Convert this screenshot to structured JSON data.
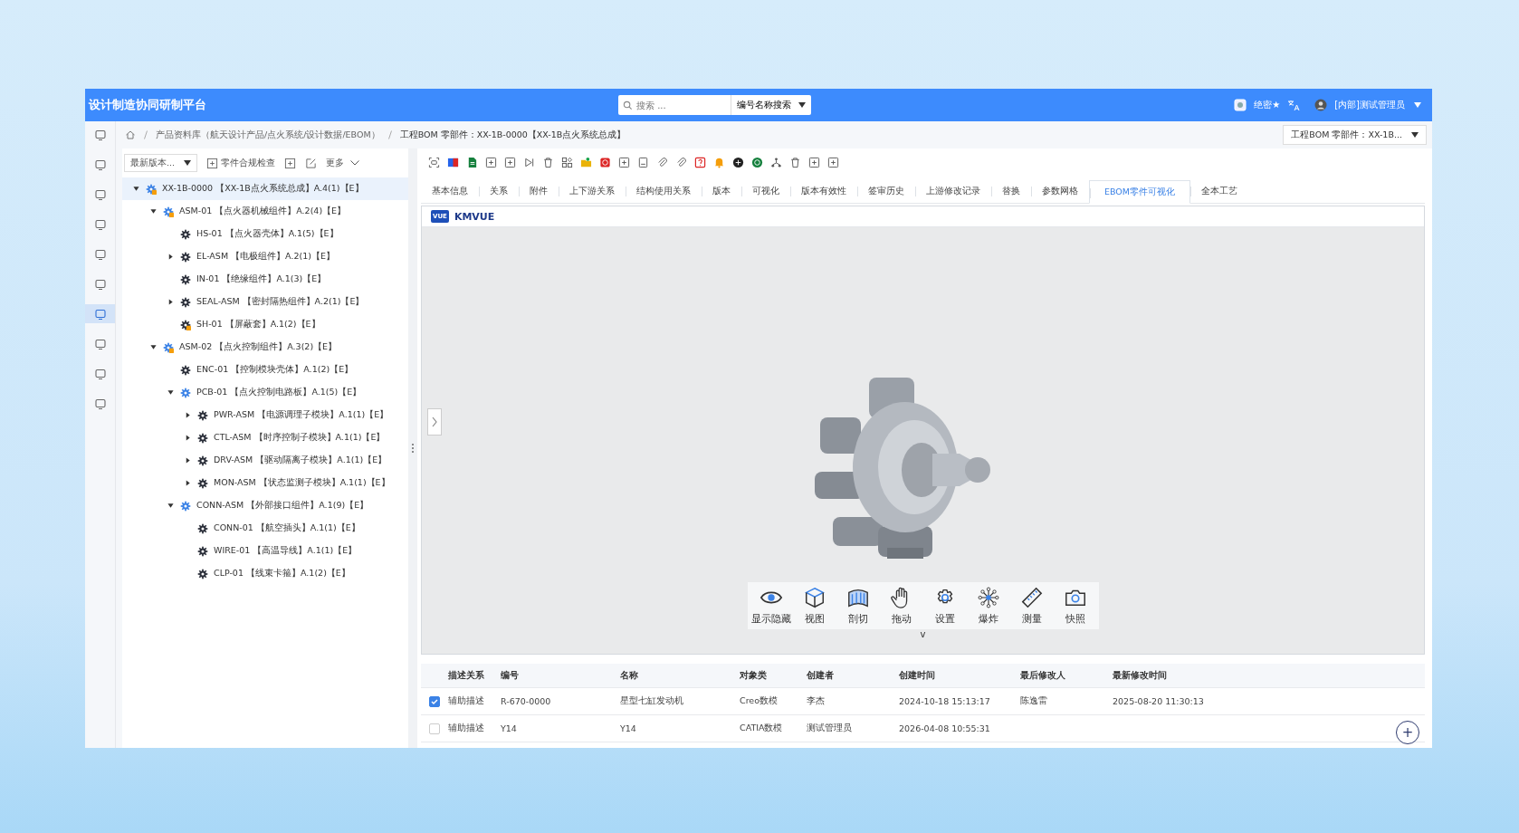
{
  "header": {
    "title": "设计制造协同研制平台",
    "search": {
      "placeholder": "搜索 ...",
      "mode": "编号名称搜索"
    },
    "security": "绝密★",
    "user": "[内部]测试管理员"
  },
  "rail": [
    {
      "selected": false
    },
    {
      "selected": false
    },
    {
      "selected": false
    },
    {
      "selected": false
    },
    {
      "selected": false
    },
    {
      "selected": false
    },
    {
      "selected": true
    },
    {
      "selected": false
    },
    {
      "selected": false
    },
    {
      "selected": false
    }
  ],
  "breadcrumb": [
    "产品资料库（航天设计产品/点火系统/设计数据/EBOM）",
    "工程BOM 零部件：XX-1B-0000【XX-1B点火系统总成】"
  ],
  "object_select": "工程BOM 零部件：XX-1B...",
  "tree_toolbar": {
    "version_select": "最新版本...",
    "check_button": "零件合规检查",
    "more": "更多"
  },
  "tree": [
    {
      "label": "XX-1B-0000 【XX-1B点火系统总成】A.4(1)【E】",
      "kind": "assembly",
      "expanded": true,
      "selected": true,
      "children": [
        {
          "label": "ASM-01 【点火器机械组件】A.2(4)【E】",
          "kind": "assembly",
          "expanded": true,
          "selected": false,
          "children": [
            {
              "label": "HS-01 【点火器壳体】A.1(5)【E】",
              "kind": "part",
              "selected": false
            },
            {
              "label": "EL-ASM 【电极组件】A.2(1)【E】",
              "kind": "part",
              "expanded": false,
              "selected": false
            },
            {
              "label": "IN-01 【绝缘组件】A.1(3)【E】",
              "kind": "part",
              "selected": false
            },
            {
              "label": "SEAL-ASM 【密封隔热组件】A.2(1)【E】",
              "kind": "part",
              "expanded": false,
              "selected": false
            },
            {
              "label": "SH-01 【屏蔽套】A.1(2)【E】",
              "kind": "marked",
              "selected": false
            }
          ]
        },
        {
          "label": "ASM-02 【点火控制组件】A.3(2)【E】",
          "kind": "assembly",
          "expanded": true,
          "selected": false,
          "children": [
            {
              "label": "ENC-01 【控制模块壳体】A.1(2)【E】",
              "kind": "part",
              "selected": false
            },
            {
              "label": "PCB-01 【点火控制电路板】A.1(5)【E】",
              "kind": "sub",
              "expanded": true,
              "selected": false,
              "children": [
                {
                  "label": "PWR-ASM 【电源调理子模块】A.1(1)【E】",
                  "kind": "part",
                  "expanded": false,
                  "selected": false
                },
                {
                  "label": "CTL-ASM 【时序控制子模块】A.1(1)【E】",
                  "kind": "part",
                  "expanded": false,
                  "selected": false
                },
                {
                  "label": "DRV-ASM 【驱动隔离子模块】A.1(1)【E】",
                  "kind": "part",
                  "expanded": false,
                  "selected": false
                },
                {
                  "label": "MON-ASM 【状态监测子模块】A.1(1)【E】",
                  "kind": "part",
                  "expanded": false,
                  "selected": false
                }
              ]
            },
            {
              "label": "CONN-ASM 【外部接口组件】A.1(9)【E】",
              "kind": "sub",
              "expanded": true,
              "selected": false,
              "children": [
                {
                  "label": "CONN-01 【航空插头】A.1(1)【E】",
                  "kind": "part",
                  "selected": false
                },
                {
                  "label": "WIRE-01 【高温导线】A.1(1)【E】",
                  "kind": "part",
                  "selected": false
                },
                {
                  "label": "CLP-01 【线束卡箍】A.1(2)【E】",
                  "kind": "part",
                  "selected": false
                }
              ]
            }
          ]
        }
      ]
    }
  ],
  "tabs": [
    {
      "label": "基本信息",
      "selected": false
    },
    {
      "label": "关系",
      "selected": false
    },
    {
      "label": "附件",
      "selected": false
    },
    {
      "label": "上下游关系",
      "selected": false
    },
    {
      "label": "结构使用关系",
      "selected": false
    },
    {
      "label": "版本",
      "selected": false
    },
    {
      "label": "可视化",
      "selected": false
    },
    {
      "label": "版本有效性",
      "selected": false
    },
    {
      "label": "签审历史",
      "selected": false
    },
    {
      "label": "上游修改记录",
      "selected": false
    },
    {
      "label": "替换",
      "selected": false
    },
    {
      "label": "参数网格",
      "selected": false
    },
    {
      "label": "EBOM零件可视化",
      "selected": true
    },
    {
      "label": "全本工艺",
      "selected": false
    }
  ],
  "viewer": {
    "logo": "VUE",
    "title": "KMVUE",
    "tools": [
      {
        "kind": "eye",
        "label": "显示隐藏"
      },
      {
        "kind": "cube",
        "label": "视图"
      },
      {
        "kind": "section",
        "label": "剖切"
      },
      {
        "kind": "hand",
        "label": "拖动"
      },
      {
        "kind": "gear",
        "label": "设置"
      },
      {
        "kind": "explode",
        "label": "爆炸"
      },
      {
        "kind": "ruler",
        "label": "测量"
      },
      {
        "kind": "camera",
        "label": "快照"
      }
    ],
    "collapse": "v"
  },
  "table": {
    "columns": [
      "描述关系",
      "编号",
      "名称",
      "对象类",
      "创建者",
      "创建时间",
      "最后修改人",
      "最新修改时间"
    ],
    "rows": [
      {
        "checked": true,
        "cells": [
          "辅助描述",
          "R-670-0000",
          "星型七缸发动机",
          "Creo数模",
          "李杰",
          "2024-10-18 15:13:17",
          "陈逸雷",
          "2025-08-20 11:30:13"
        ]
      },
      {
        "checked": false,
        "cells": [
          "辅助描述",
          "Y14",
          "Y14",
          "CATIA数模",
          "测试管理员",
          "2026-04-08 10:55:31",
          "",
          ""
        ]
      }
    ]
  },
  "fab": "+"
}
